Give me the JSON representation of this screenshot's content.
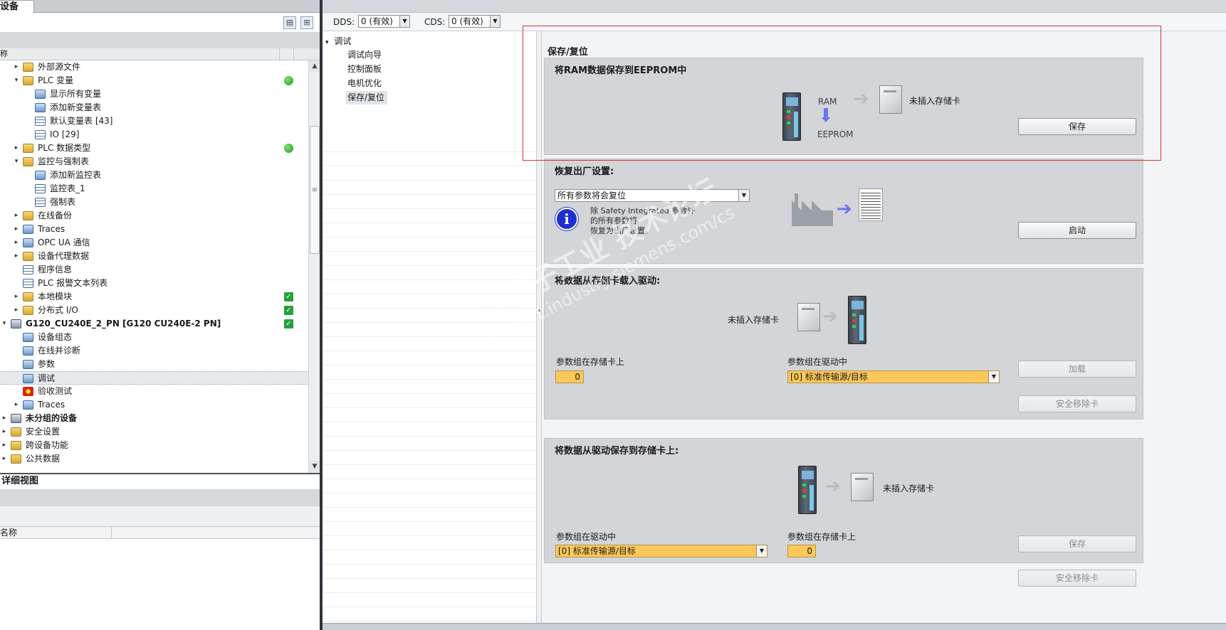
{
  "left_panel": {
    "tab_label": "设备",
    "column_header": "称",
    "tree": [
      {
        "label": "外部源文件",
        "level": 2,
        "expand": "▸",
        "icon": "folder",
        "status": ""
      },
      {
        "label": "PLC 变量",
        "level": 2,
        "expand": "▾",
        "icon": "folder",
        "status": "dot"
      },
      {
        "label": "显示所有变量",
        "level": 3,
        "expand": "",
        "icon": "blue",
        "status": ""
      },
      {
        "label": "添加新变量表",
        "level": 3,
        "expand": "",
        "icon": "blue",
        "status": ""
      },
      {
        "label": "默认变量表 [43]",
        "level": 3,
        "expand": "",
        "icon": "table",
        "status": ""
      },
      {
        "label": "IO [29]",
        "level": 3,
        "expand": "",
        "icon": "table",
        "status": ""
      },
      {
        "label": "PLC 数据类型",
        "level": 2,
        "expand": "▸",
        "icon": "folder",
        "status": "dot"
      },
      {
        "label": "监控与强制表",
        "level": 2,
        "expand": "▾",
        "icon": "folder",
        "status": ""
      },
      {
        "label": "添加新监控表",
        "level": 3,
        "expand": "",
        "icon": "blue",
        "status": ""
      },
      {
        "label": "监控表_1",
        "level": 3,
        "expand": "",
        "icon": "table",
        "status": ""
      },
      {
        "label": "强制表",
        "level": 3,
        "expand": "",
        "icon": "table",
        "status": ""
      },
      {
        "label": "在线备份",
        "level": 2,
        "expand": "▸",
        "icon": "folder",
        "status": ""
      },
      {
        "label": "Traces",
        "level": 2,
        "expand": "▸",
        "icon": "blue",
        "status": ""
      },
      {
        "label": "OPC UA 通信",
        "level": 2,
        "expand": "▸",
        "icon": "blue",
        "status": ""
      },
      {
        "label": "设备代理数据",
        "level": 2,
        "expand": "▸",
        "icon": "folder",
        "status": ""
      },
      {
        "label": "程序信息",
        "level": 2,
        "expand": "",
        "icon": "table",
        "status": ""
      },
      {
        "label": "PLC 报警文本列表",
        "level": 2,
        "expand": "",
        "icon": "table",
        "status": ""
      },
      {
        "label": "本地模块",
        "level": 2,
        "expand": "▸",
        "icon": "folder",
        "status": "check"
      },
      {
        "label": "分布式 I/O",
        "level": 2,
        "expand": "▸",
        "icon": "folder",
        "status": "check"
      },
      {
        "label": "G120_CU240E_2_PN [G120 CU240E-2 PN]",
        "level": 1,
        "expand": "▾",
        "icon": "dev",
        "status": "check",
        "bold": true
      },
      {
        "label": "设备组态",
        "level": 2,
        "expand": "",
        "icon": "blue",
        "status": ""
      },
      {
        "label": "在线并诊断",
        "level": 2,
        "expand": "",
        "icon": "blue",
        "status": ""
      },
      {
        "label": "参数",
        "level": 2,
        "expand": "",
        "icon": "blue",
        "status": ""
      },
      {
        "label": "调试",
        "level": 2,
        "expand": "",
        "icon": "blue",
        "status": "",
        "selected": true
      },
      {
        "label": "验收测试",
        "level": 2,
        "expand": "",
        "icon": "red",
        "status": ""
      },
      {
        "label": "Traces",
        "level": 2,
        "expand": "▸",
        "icon": "blue",
        "status": ""
      },
      {
        "label": "未分组的设备",
        "level": 1,
        "expand": "▸",
        "icon": "dev",
        "status": "",
        "bold": true
      },
      {
        "label": "安全设置",
        "level": 1,
        "expand": "▸",
        "icon": "folder",
        "status": ""
      },
      {
        "label": "跨设备功能",
        "level": 1,
        "expand": "▸",
        "icon": "folder",
        "status": ""
      },
      {
        "label": "公共数据",
        "level": 1,
        "expand": "▸",
        "icon": "folder",
        "status": ""
      }
    ],
    "detail_title": "详细视图",
    "detail_column": "名称"
  },
  "toolbar": {
    "dds_label": "DDS:",
    "dds_value": "0 (有效)",
    "cds_label": "CDS:",
    "cds_value": "0 (有效)"
  },
  "nav": {
    "root": "调试",
    "items": [
      "调试向导",
      "控制面板",
      "电机优化",
      "保存/复位"
    ],
    "selected_index": 3
  },
  "content": {
    "section_title": "保存/复位",
    "ram": {
      "title": "将RAM数据保存到EEPROM中",
      "ram_label": "RAM",
      "eeprom_label": "EEPROM",
      "card_status": "未插入存储卡",
      "button": "保存"
    },
    "factory": {
      "title": "恢复出厂设置:",
      "dropdown_value": "所有参数将会复位",
      "info_text_lines": [
        "除 Safety Integrated 参数外",
        "的所有参数将",
        "恢复为出厂设置。"
      ],
      "button": "启动"
    },
    "load": {
      "title": "将数据从存储卡载入驱动:",
      "card_status": "未插入存储卡",
      "card_param_label": "参数组在存储卡上",
      "card_param_value": "0",
      "drive_param_label": "参数组在驱动中",
      "drive_param_value": "[0] 标准传输源/目标",
      "button_load": "加载",
      "button_remove": "安全移除卡"
    },
    "store": {
      "title": "将数据从驱动保存到存储卡上:",
      "card_status": "未插入存储卡",
      "drive_param_label": "参数组在驱动中",
      "drive_param_value": "[0] 标准传输源/目标",
      "card_param_label": "参数组在存储卡上",
      "card_param_value": "0",
      "button_save": "保存",
      "button_remove": "安全移除卡"
    }
  },
  "watermark": {
    "text": "西门子工业 技术论坛",
    "url": "support.industry.siemens.com/cs"
  },
  "colors": {
    "accent_orange": "#fcc85a",
    "highlight_red": "#d8333c",
    "arrow_blue": "#6d74ef",
    "status_green": "#23a23a"
  }
}
